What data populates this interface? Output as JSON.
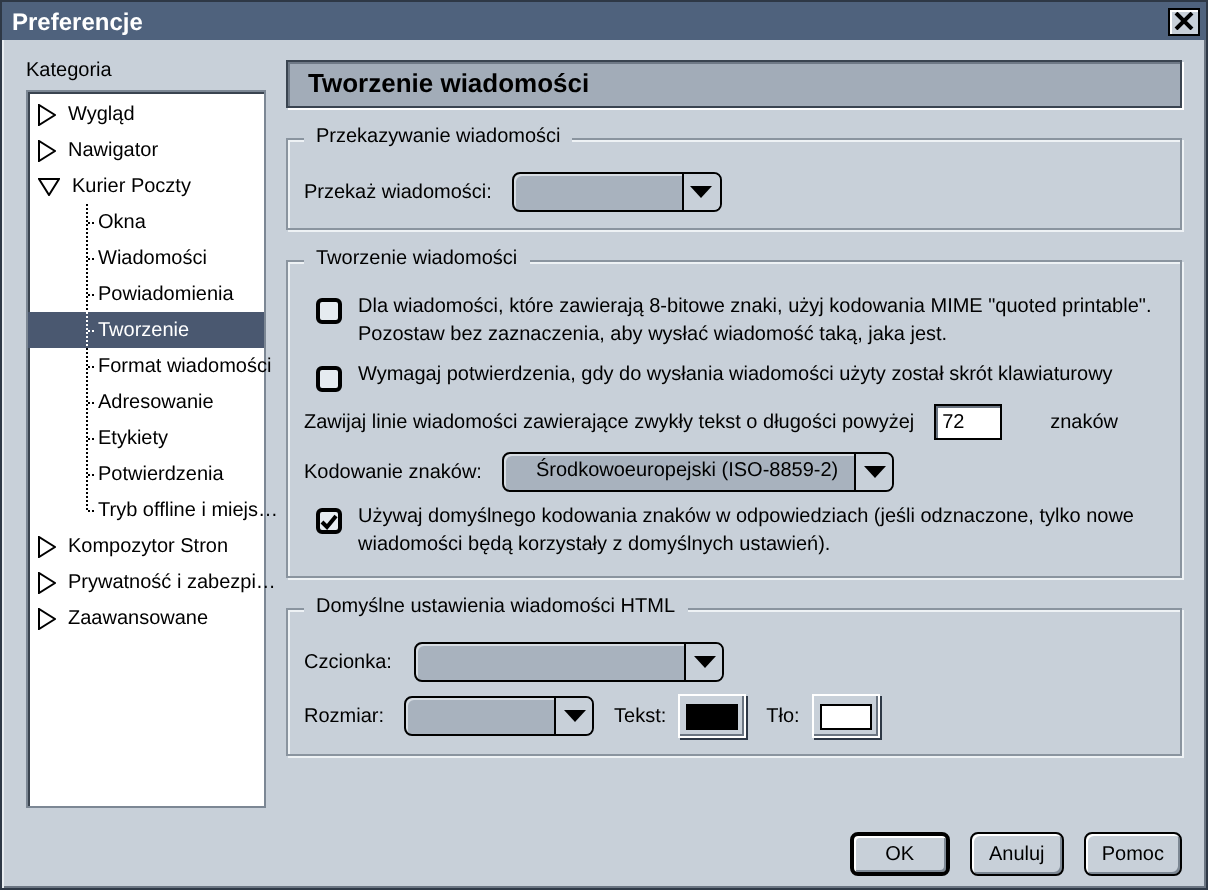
{
  "window": {
    "title": "Preferencje"
  },
  "sidebar": {
    "label": "Kategoria",
    "tree": [
      {
        "label": "Wygląd",
        "expanded": false,
        "selected": false
      },
      {
        "label": "Nawigator",
        "expanded": false,
        "selected": false
      },
      {
        "label": "Kurier Poczty",
        "expanded": true,
        "selected": false,
        "children": [
          {
            "label": "Okna",
            "selected": false
          },
          {
            "label": "Wiadomości",
            "selected": false
          },
          {
            "label": "Powiadomienia",
            "selected": false
          },
          {
            "label": "Tworzenie",
            "selected": true
          },
          {
            "label": "Format wiadomości",
            "selected": false
          },
          {
            "label": "Adresowanie",
            "selected": false
          },
          {
            "label": "Etykiety",
            "selected": false
          },
          {
            "label": "Potwierdzenia",
            "selected": false
          },
          {
            "label": "Tryb offline i miejs…",
            "selected": false
          }
        ]
      },
      {
        "label": "Kompozytor Stron",
        "expanded": false,
        "selected": false
      },
      {
        "label": "Prywatność i zabezpi…",
        "expanded": false,
        "selected": false
      },
      {
        "label": "Zaawansowane",
        "expanded": false,
        "selected": false
      }
    ]
  },
  "panel": {
    "title": "Tworzenie wiadomości",
    "groups": [
      {
        "title": "Przekazywanie wiadomości",
        "rows": [
          {
            "items": [
              {
                "kind": "dropdown",
                "label": "Przekaż wiadomości:"
              }
            ]
          }
        ]
      },
      {
        "title": "Tworzenie wiadomości",
        "rows": [
          {
            "items": [
              {
                "kind": "checkbox",
                "label": "Dla wiadomości, które zawierają 8-bitowe znaki, użyj kodowania MIME \"quoted printable\". Pozostaw bez zaznaczenia, aby wysłać wiadomość taką, jaka jest.",
                "checked": false
              }
            ]
          },
          {
            "items": [
              {
                "kind": "checkbox",
                "label": "Wymagaj potwierdzenia, gdy do wysłania wiadomości użyty został skrót klawiaturowy",
                "checked": false
              }
            ]
          },
          {
            "items": [
              {
                "kind": "number",
                "label": "Zawijaj linie wiadomości zawierające zwykły tekst o długości powyżej",
                "value": "72",
                "unit": "znaków"
              }
            ]
          },
          {
            "items": [
              {
                "kind": "dropdown",
                "label": "Kodowanie znaków:",
                "value": "Środkowoeuropejski (ISO-8859-2)"
              }
            ]
          },
          {
            "items": [
              {
                "kind": "checkbox",
                "label": "Używaj domyślnego kodowania znaków w odpowiedziach (jeśli odznaczone, tylko nowe wiadomości będą korzystały z domyślnych ustawień).",
                "checked": true
              }
            ]
          }
        ]
      },
      {
        "title": "Domyślne ustawienia wiadomości HTML",
        "rows": [
          {
            "items": [
              {
                "kind": "dropdown",
                "label": "Czcionka:"
              }
            ]
          },
          {
            "items": [
              {
                "kind": "dropdown",
                "label": "Rozmiar:"
              },
              {
                "kind": "color",
                "label": "Tekst:",
                "color": "#000000"
              },
              {
                "kind": "color",
                "label": "Tło:",
                "color": "#ffffff"
              }
            ]
          }
        ]
      }
    ]
  },
  "buttons": [
    {
      "label": "OK",
      "default": true
    },
    {
      "label": "Anuluj",
      "default": false
    },
    {
      "label": "Pomoc",
      "default": false
    }
  ]
}
